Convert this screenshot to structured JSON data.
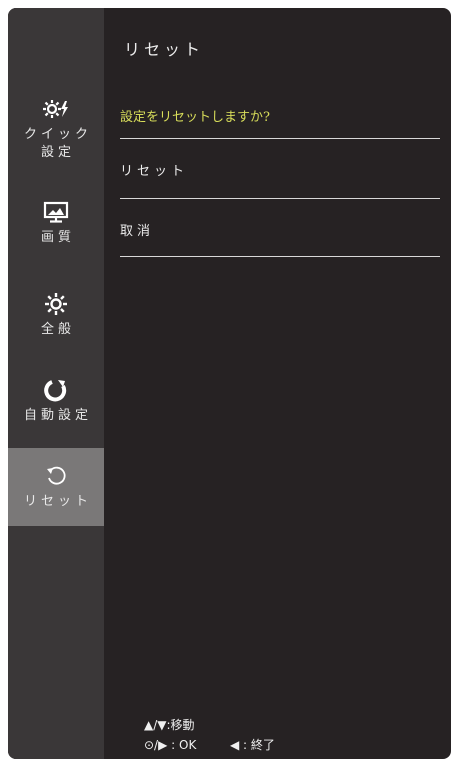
{
  "sidebar": {
    "items": [
      {
        "label": "クイック\n設定",
        "icon": "quick-settings-icon"
      },
      {
        "label": "画質",
        "icon": "monitor-icon"
      },
      {
        "label": "全般",
        "icon": "gear-icon"
      },
      {
        "label": "自動設定",
        "icon": "auto-adjust-icon"
      },
      {
        "label": "リセット",
        "icon": "reset-icon",
        "active": true
      }
    ]
  },
  "main": {
    "title": "リセット",
    "prompt": "設定をリセットしますか?",
    "options": [
      "リセット",
      "取消"
    ]
  },
  "footer": {
    "move_keys": "▲/▼",
    "move_label": "移動",
    "ok_keys": "⊙/▶",
    "ok_label": "OK",
    "exit_keys": "◀",
    "exit_label": "終了"
  },
  "colors": {
    "background": "#262223",
    "sidebar": "#3a3738",
    "active_item": "#7a7878",
    "prompt": "#d8dd5a"
  }
}
